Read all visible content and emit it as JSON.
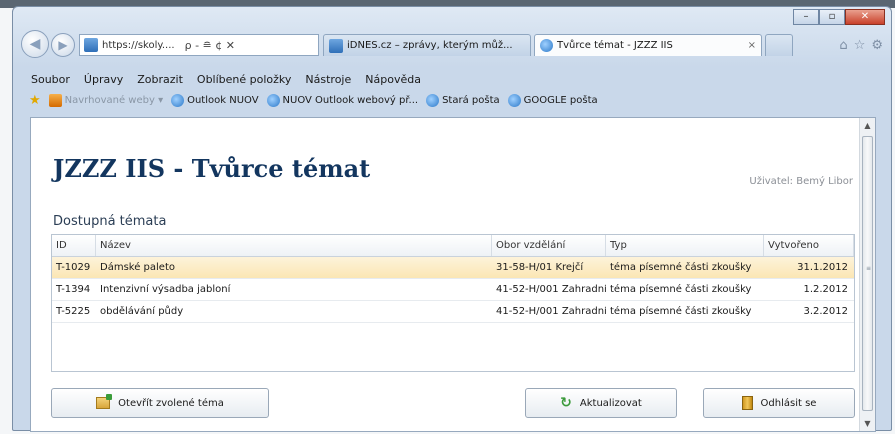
{
  "browser": {
    "address_url": "https://skoly....",
    "address_tools": "ρ - ≘ ¢ ✕",
    "tabs": [
      {
        "label": "iDNES.cz – zprávy, kterým můž..."
      },
      {
        "label": "Tvůrce témat - JZZZ IIS",
        "close": "×"
      }
    ],
    "menu": [
      "Soubor",
      "Úpravy",
      "Zobrazit",
      "Oblíbené položky",
      "Nástroje",
      "Nápověda"
    ],
    "favorites": [
      {
        "label": "Navrhované weby ▾",
        "dim": true
      },
      {
        "label": "Outlook NUOV"
      },
      {
        "label": "NUOV Outlook webový př..."
      },
      {
        "label": "Stará pošta"
      },
      {
        "label": "GOOGLE pošta"
      }
    ]
  },
  "app": {
    "title": "JZZZ IIS - Tvůrce témat",
    "user": "Uživatel: Bemý Libor",
    "section_title": "Dostupná témata",
    "table": {
      "headers": [
        "ID",
        "Název",
        "Obor vzdělání",
        "Typ",
        "Vytvořeno"
      ],
      "rows": [
        {
          "id": "T-1029",
          "name": "Dámské paleto",
          "obor": "31-58-H/01 Krejčí",
          "typ": "téma písemné části zkoušky",
          "date": "31.1.2012",
          "selected": true
        },
        {
          "id": "T-1394",
          "name": "Intenzivní výsadba jabloní",
          "obor": "41-52-H/001 Zahradník",
          "typ": "téma písemné části zkoušky",
          "date": "1.2.2012"
        },
        {
          "id": "T-5225",
          "name": "obdělávání půdy",
          "obor": "41-52-H/001 Zahradník",
          "typ": "téma písemné části zkoušky",
          "date": "3.2.2012"
        }
      ]
    },
    "buttons": {
      "open": "Otevřít zvolené téma",
      "refresh": "Aktualizovat",
      "logout": "Odhlásit se"
    }
  }
}
